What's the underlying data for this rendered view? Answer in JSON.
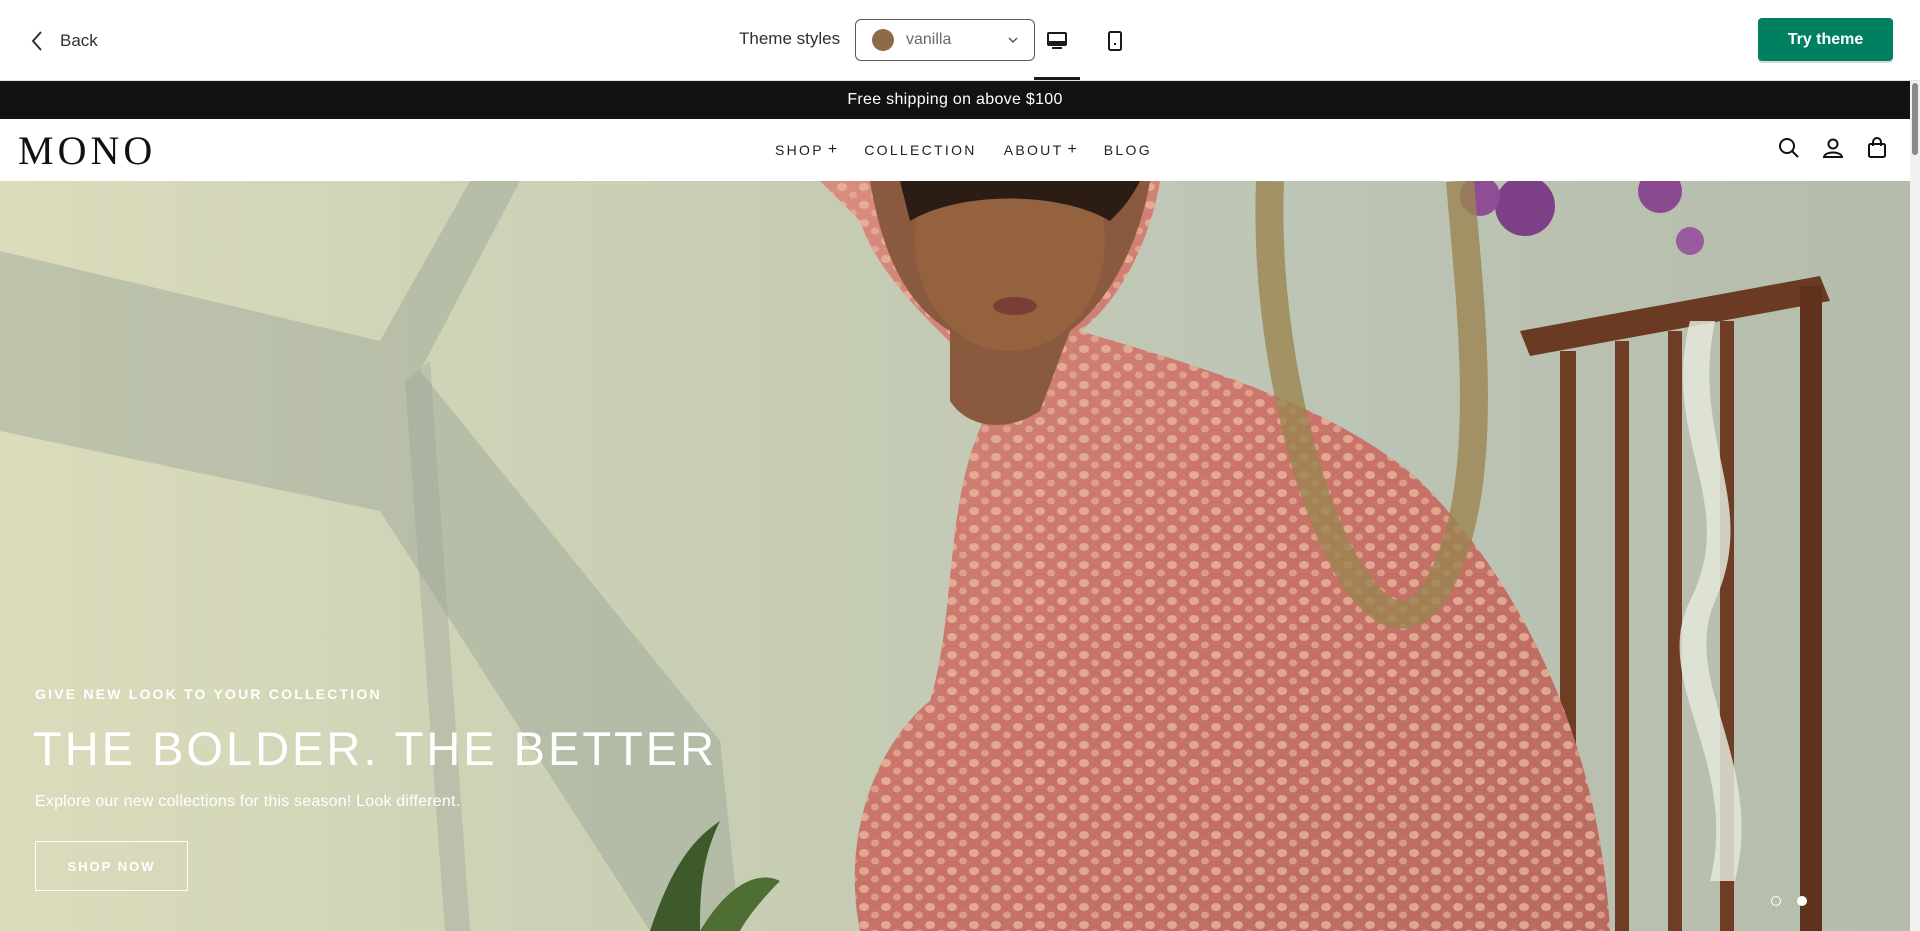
{
  "editor": {
    "back_label": "Back",
    "theme_styles_label": "Theme styles",
    "theme_select_value": "vanilla",
    "swatch_color": "#8c6a46",
    "try_theme_label": "Try theme",
    "try_theme_color": "#008060",
    "view_modes": [
      {
        "name": "desktop",
        "icon": "desktop-icon",
        "selected": true
      },
      {
        "name": "mobile",
        "icon": "mobile-icon",
        "selected": false
      }
    ]
  },
  "store": {
    "announcement": "Free shipping on above $100",
    "logo": "MONO",
    "nav": [
      {
        "label": "SHOP",
        "has_submenu": true,
        "plus": "+"
      },
      {
        "label": "COLLECTION",
        "has_submenu": false
      },
      {
        "label": "ABOUT",
        "has_submenu": true,
        "plus": "+"
      },
      {
        "label": "BLOG",
        "has_submenu": false
      }
    ],
    "header_icons": [
      "search-icon",
      "account-icon",
      "cart-icon"
    ],
    "hero": {
      "subheading": "GIVE NEW LOOK TO YOUR COLLECTION",
      "heading": "THE BOLDER. THE BETTER",
      "text": "Explore our new collections for this season! Look different.",
      "button_label": "SHOP NOW",
      "slides": 2,
      "active_slide": 2
    }
  }
}
